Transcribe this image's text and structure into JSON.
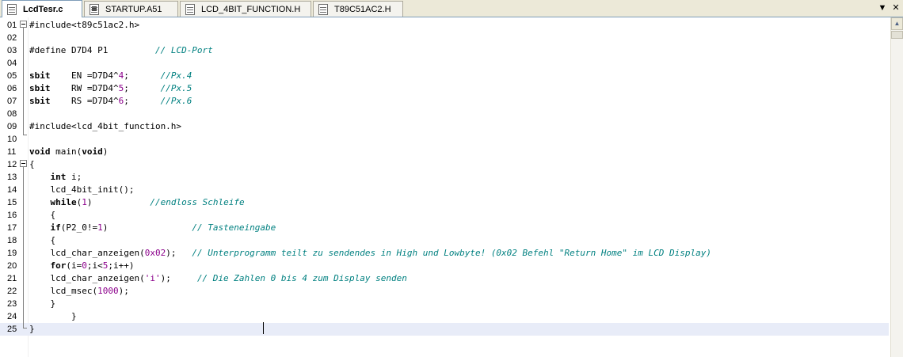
{
  "tabs": [
    {
      "label": "LcdTesr.c",
      "active": true,
      "icon": "c-file-icon"
    },
    {
      "label": "STARTUP.A51",
      "active": false,
      "icon": "asm-file-icon"
    },
    {
      "label": "LCD_4BIT_FUNCTION.H",
      "active": false,
      "icon": "header-file-icon"
    },
    {
      "label": "T89C51AC2.H",
      "active": false,
      "icon": "header-file-icon"
    }
  ],
  "tab_controls": {
    "dropdown": "▼",
    "close": "✕"
  },
  "scrollbar": {
    "up": "▲"
  },
  "editor": {
    "current_line": 25,
    "lines": [
      {
        "n": "01",
        "html": "#include&lt;t89c51ac2.h&gt;"
      },
      {
        "n": "02",
        "html": ""
      },
      {
        "n": "03",
        "html": "#define D7D4 P1         <span class=\"cm\">// LCD-Port</span>"
      },
      {
        "n": "04",
        "html": ""
      },
      {
        "n": "05",
        "html": "<span class=\"kw\">sbit</span>    EN =D7D4^<span class=\"num\">4</span>;      <span class=\"cm\">//Px.4</span>"
      },
      {
        "n": "06",
        "html": "<span class=\"kw\">sbit</span>    RW =D7D4^<span class=\"num\">5</span>;      <span class=\"cm\">//Px.5</span>"
      },
      {
        "n": "07",
        "html": "<span class=\"kw\">sbit</span>    RS =D7D4^<span class=\"num\">6</span>;      <span class=\"cm\">//Px.6</span>"
      },
      {
        "n": "08",
        "html": ""
      },
      {
        "n": "09",
        "html": "#include&lt;lcd_4bit_function.h&gt;"
      },
      {
        "n": "10",
        "html": ""
      },
      {
        "n": "11",
        "html": "<span class=\"kw\">void</span> main(<span class=\"kw\">void</span>)"
      },
      {
        "n": "12",
        "html": "{"
      },
      {
        "n": "13",
        "html": "    <span class=\"kw\">int</span> i;"
      },
      {
        "n": "14",
        "html": "    lcd_4bit_init();"
      },
      {
        "n": "15",
        "html": "    <span class=\"kw\">while</span>(<span class=\"num\">1</span>)           <span class=\"cm\">//endloss Schleife</span>"
      },
      {
        "n": "16",
        "html": "    {"
      },
      {
        "n": "17",
        "html": "    <span class=\"kw\">if</span>(P2_0!=<span class=\"num\">1</span>)                <span class=\"cm\">// Tasteneingabe</span>"
      },
      {
        "n": "18",
        "html": "    {"
      },
      {
        "n": "19",
        "html": "    lcd_char_anzeigen(<span class=\"num\">0x02</span>);   <span class=\"cm\">// Unterprogramm teilt zu sendendes in High und Lowbyte! (0x02 Befehl \"Return Home\" im LCD Display)</span>"
      },
      {
        "n": "20",
        "html": "    <span class=\"kw\">for</span>(i=<span class=\"num\">0</span>;i&lt;<span class=\"num\">5</span>;i++)"
      },
      {
        "n": "21",
        "html": "    lcd_char_anzeigen(<span class=\"str\">'i'</span>);     <span class=\"cm\">// Die Zahlen 0 bis 4 zum Display senden</span>"
      },
      {
        "n": "22",
        "html": "    lcd_msec(<span class=\"num\">1000</span>);"
      },
      {
        "n": "23",
        "html": "    }"
      },
      {
        "n": "24",
        "html": "        }"
      },
      {
        "n": "25",
        "html": "}"
      }
    ]
  },
  "colors": {
    "keyword": "#000000",
    "comment": "#008080",
    "number": "#8b008b",
    "current_line_bg": "#e8ecf8"
  }
}
